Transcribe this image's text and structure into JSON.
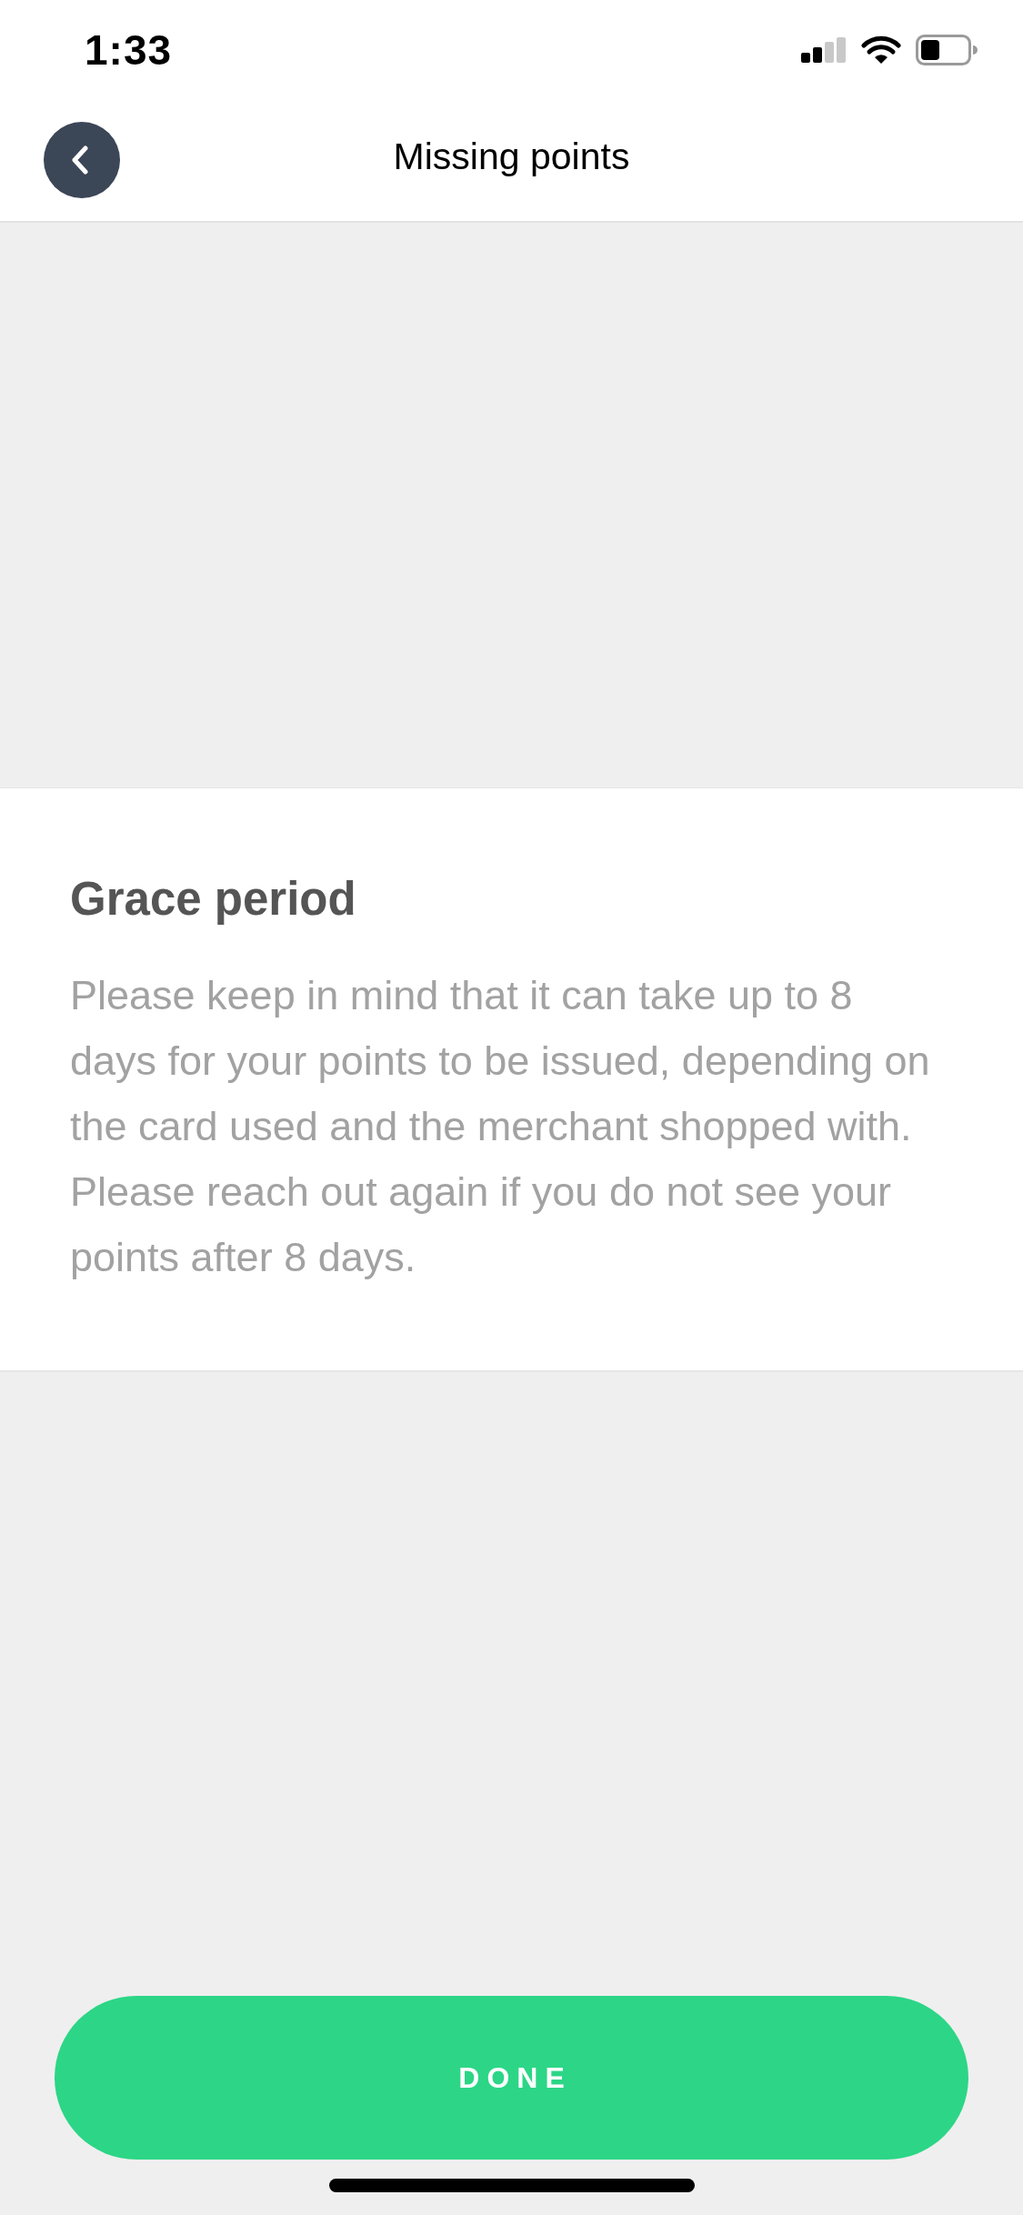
{
  "status_bar": {
    "time": "1:33"
  },
  "header": {
    "title": "Missing points"
  },
  "info_card": {
    "heading": "Grace period",
    "body": "Please keep in mind that it can take up to 8 days for your points to be issued, depending on the card used and the merchant shopped with. Please reach out again if you do not see your points after 8 days."
  },
  "done_button": {
    "label": "DONE"
  }
}
